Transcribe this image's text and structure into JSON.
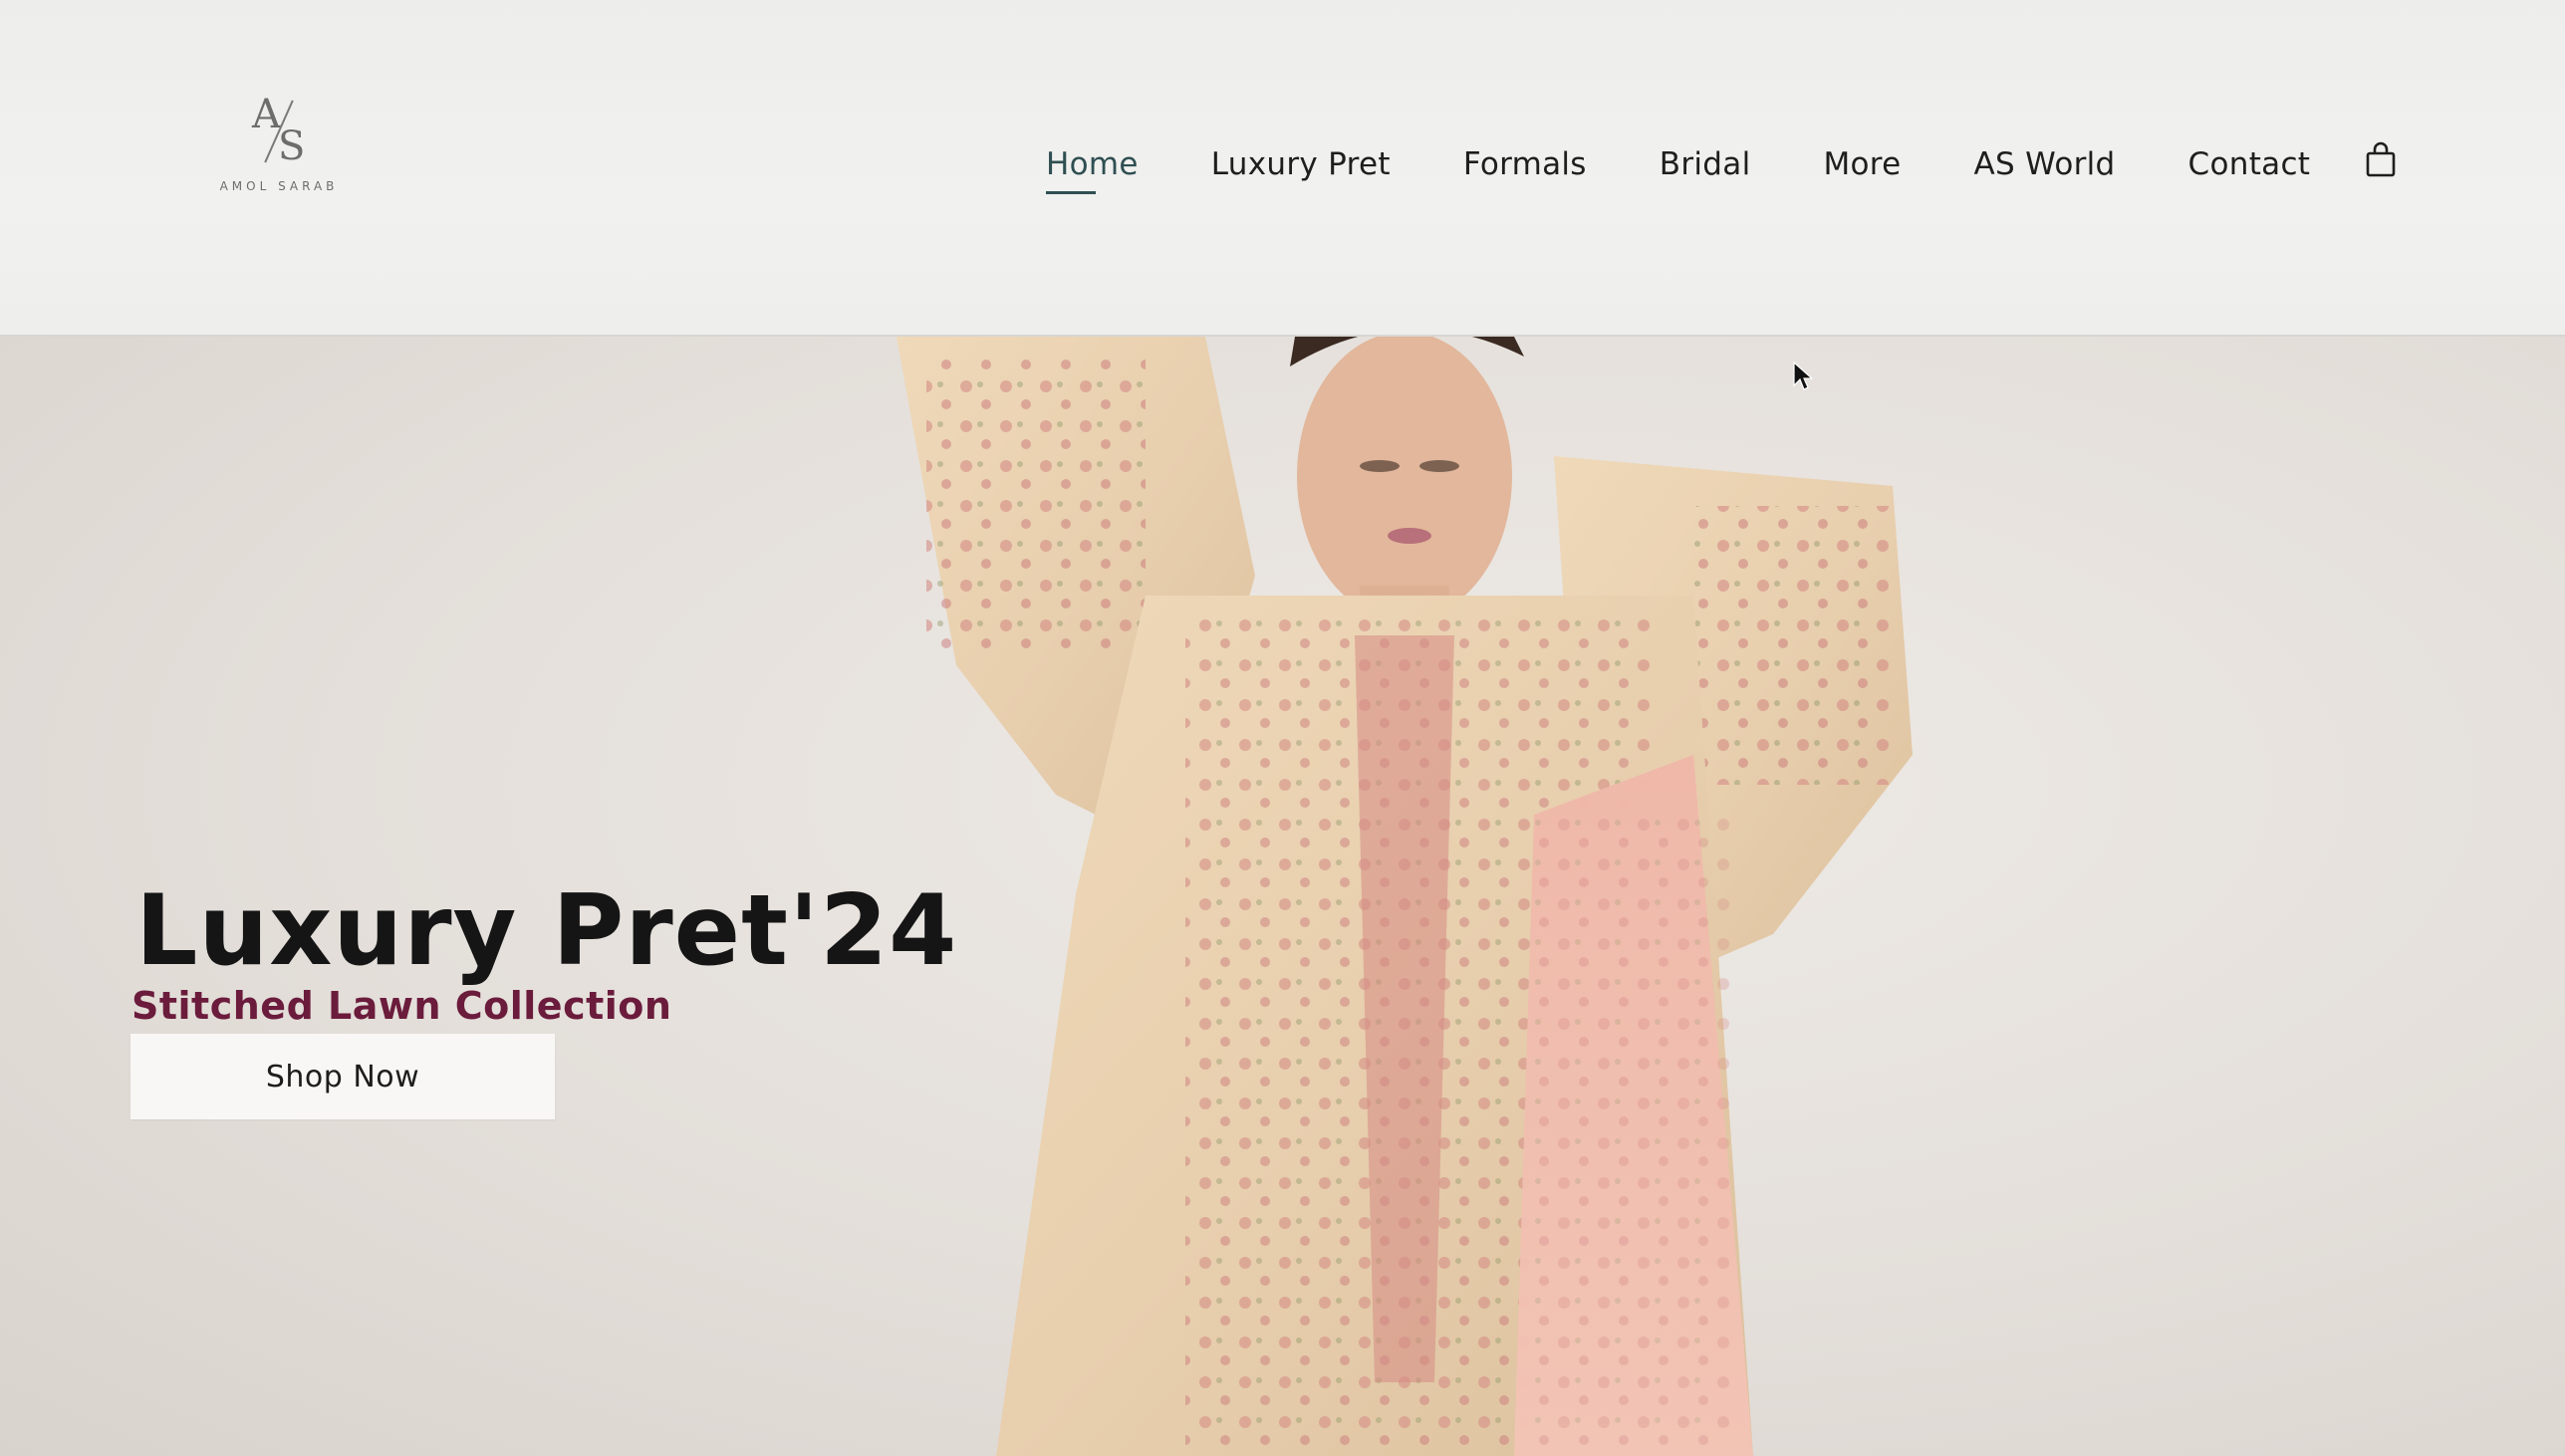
{
  "brand": {
    "logo_text": "AMOL SARAB"
  },
  "nav": {
    "items": [
      {
        "label": "Home",
        "active": true
      },
      {
        "label": "Luxury Pret",
        "active": false
      },
      {
        "label": "Formals",
        "active": false
      },
      {
        "label": "Bridal",
        "active": false
      },
      {
        "label": "More",
        "active": false
      },
      {
        "label": "AS World",
        "active": false
      },
      {
        "label": "Contact",
        "active": false
      }
    ],
    "cart_icon": "shopping-bag-icon"
  },
  "hero": {
    "title": "Luxury Pret'24",
    "subtitle": "Stitched Lawn Collection",
    "cta_label": "Shop Now"
  },
  "colors": {
    "header_bg": "#efefed",
    "hero_bg": "#e4dfda",
    "nav_active": "#2f4f52",
    "subtitle": "#6b1b3c",
    "title": "#151515",
    "button_bg": "#f8f7f5"
  }
}
